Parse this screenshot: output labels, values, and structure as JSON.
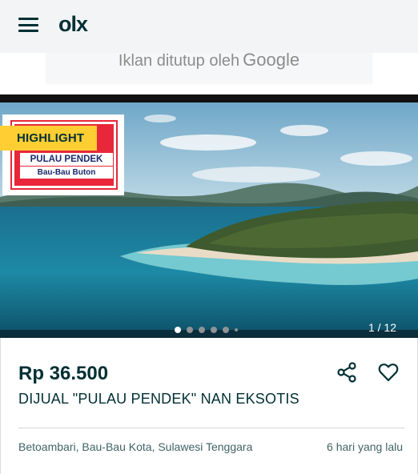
{
  "header": {
    "brand": "olx",
    "menu_icon": "hamburger-menu-icon"
  },
  "ad_banner": {
    "text": "Iklan ditutup oleh",
    "brand": "Google"
  },
  "gallery": {
    "badge": "HIGHLIGHT",
    "thumbnail_title": "PULAU PENDEK",
    "thumbnail_subtitle": "Bau-Bau Buton",
    "counter": "1 / 12",
    "dots_total": 6,
    "active_dot": 0
  },
  "listing": {
    "price": "Rp 36.500",
    "title": "DIJUAL \"PULAU PENDEK\" NAN EKSOTIS",
    "location": "Betoambari, Bau-Bau Kota, Sulawesi Tenggara",
    "posted": "6 hari yang lalu",
    "share_icon": "share-icon",
    "favorite_icon": "heart-icon"
  },
  "colors": {
    "brand_dark": "#002f34",
    "highlight_yellow": "#ffce32",
    "sea_teal": "#2a9bb0"
  }
}
